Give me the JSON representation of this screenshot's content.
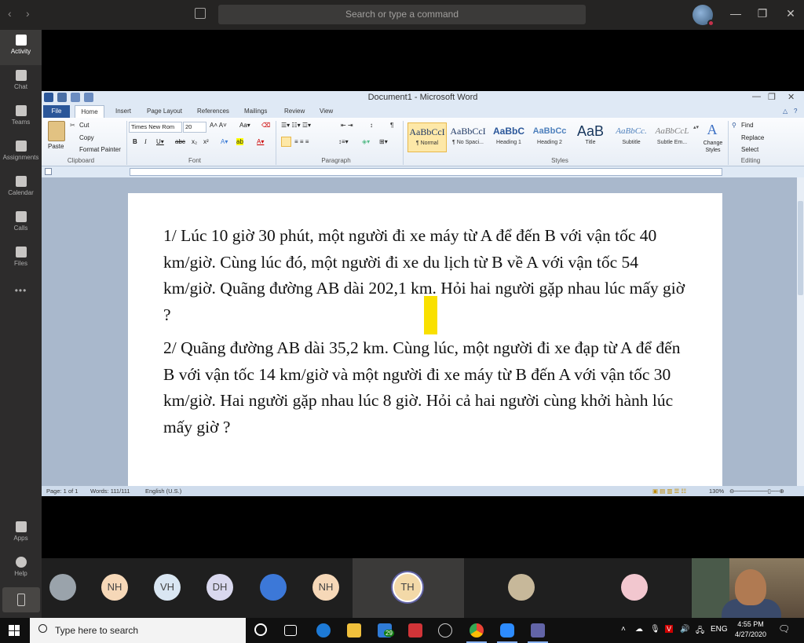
{
  "teams": {
    "search_placeholder": "Search or type a command",
    "nav_back": "‹",
    "nav_forward": "›",
    "window": {
      "minimize": "—",
      "restore": "❐",
      "close": "✕"
    },
    "rail": [
      {
        "label": "Activity",
        "icon": "bell-icon",
        "active": true
      },
      {
        "label": "Chat",
        "icon": "chat-icon"
      },
      {
        "label": "Teams",
        "icon": "teams-icon"
      },
      {
        "label": "Assignments",
        "icon": "assignments-icon"
      },
      {
        "label": "Calendar",
        "icon": "calendar-icon"
      },
      {
        "label": "Calls",
        "icon": "phone-icon"
      },
      {
        "label": "Files",
        "icon": "file-icon"
      }
    ],
    "rail_more": "•••",
    "rail_bottom": [
      {
        "label": "Apps",
        "icon": "apps-icon"
      },
      {
        "label": "Help",
        "icon": "help-icon"
      }
    ]
  },
  "word": {
    "title": "Document1 - Microsoft Word",
    "tabs": [
      "File",
      "Home",
      "Insert",
      "Page Layout",
      "References",
      "Mailings",
      "Review",
      "View"
    ],
    "clipboard": {
      "paste": "Paste",
      "cut": "Cut",
      "copy": "Copy",
      "format_painter": "Format Painter",
      "group": "Clipboard"
    },
    "font": {
      "name": "Times New Rom",
      "size": "20",
      "group": "Font"
    },
    "paragraph_group": "Paragraph",
    "styles": [
      {
        "sample": "AaBbCcI",
        "name": "¶ Normal",
        "selected": true
      },
      {
        "sample": "AaBbCcI",
        "name": "¶ No Spaci..."
      },
      {
        "sample": "AaBbC",
        "name": "Heading 1"
      },
      {
        "sample": "AaBbCc",
        "name": "Heading 2"
      },
      {
        "sample": "AaB",
        "name": "Title"
      },
      {
        "sample": "AaBbCc.",
        "name": "Subtitle"
      },
      {
        "sample": "AaBbCcL",
        "name": "Subtle Em..."
      }
    ],
    "styles_group": "Styles",
    "change_styles": "Change Styles",
    "editing": {
      "find": "Find",
      "replace": "Replace",
      "select": "Select",
      "group": "Editing"
    },
    "document": {
      "paragraphs": [
        "1/  Lúc 10 giờ 30 phút, một người đi xe máy từ A để đến B với vận tốc 40 km/giờ. Cùng lúc đó, một người đi xe du lịch từ B về A với vận tốc 54 km/giờ. Quãng đường AB dài 202,1 km. Hỏi hai người gặp nhau lúc mấy giờ ?",
        "2/  Quãng đường AB dài 35,2 km. Cùng lúc, một người đi xe đạp từ A để đến B với vận tốc 14 km/giờ và một người đi xe máy từ B đến A với vận tốc 30 km/giờ. Hai người gặp nhau lúc 8 giờ. Hỏi cả hai người cùng khởi hành lúc mấy giờ ?"
      ]
    },
    "status": {
      "page": "Page: 1 of 1",
      "words": "Words: 111/111",
      "language": "English (U.S.)",
      "zoom": "130%"
    }
  },
  "participants": [
    {
      "initials": "",
      "kind": "photo-car",
      "color": "#9aa3ab"
    },
    {
      "initials": "NH",
      "color": "#f6d8b8"
    },
    {
      "initials": "VH",
      "color": "#d9e6f2"
    },
    {
      "initials": "DH",
      "color": "#d9d8ee"
    },
    {
      "initials": "",
      "kind": "photo-cartoon",
      "color": "#3c78d8"
    },
    {
      "initials": "NH",
      "color": "#f6d8b8"
    },
    {
      "initials": "TH",
      "color": "#f3d9a8",
      "active": true
    },
    {
      "initials": "",
      "kind": "photo-flowers",
      "color": "#c7b89a"
    },
    {
      "initials": "",
      "kind": "photo-anime",
      "color": "#f2c7cf"
    }
  ],
  "taskbar": {
    "search_placeholder": "Type here to search",
    "mail_badge": "29",
    "language": "ENG",
    "time": "4:55 PM",
    "date": "4/27/2020"
  }
}
